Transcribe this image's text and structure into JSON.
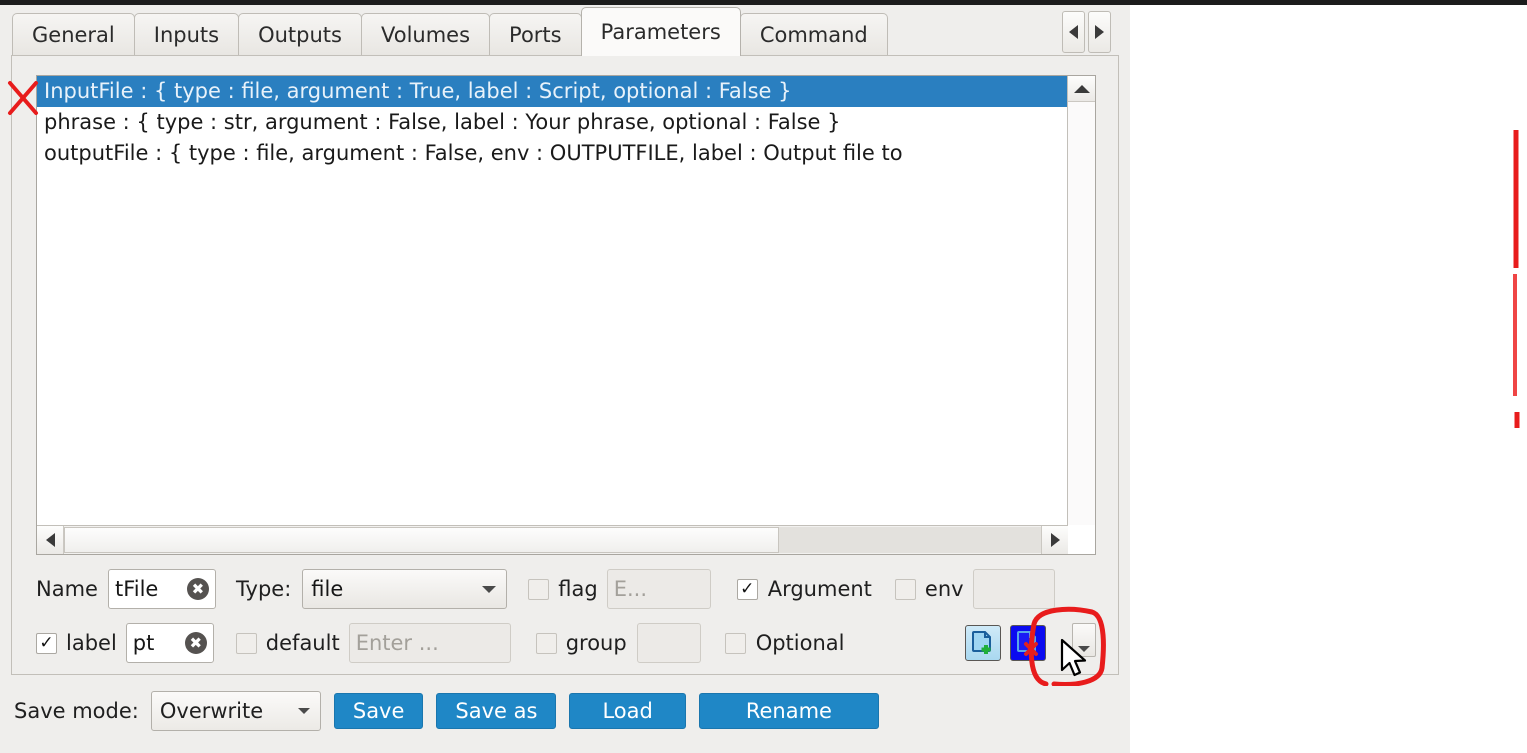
{
  "window": {
    "tabs": [
      {
        "label": "General",
        "active": false
      },
      {
        "label": "Inputs",
        "active": false
      },
      {
        "label": "Outputs",
        "active": false
      },
      {
        "label": "Volumes",
        "active": false
      },
      {
        "label": "Ports",
        "active": false
      },
      {
        "label": "Parameters",
        "active": true
      },
      {
        "label": "Command",
        "active": false
      }
    ],
    "tab_scroll_left": "◀",
    "tab_scroll_right": "▶"
  },
  "parameter_list": {
    "items": [
      {
        "text": "InputFile : { type : file,  argument : True,  label : Script,  optional : False }",
        "selected": true
      },
      {
        "text": "phrase : { type : str,  argument : False,  label : Your phrase,  optional : False }",
        "selected": false
      },
      {
        "text": "outputFile : { type : file,  argument : False,  env : OUTPUTFILE,  label : Output file to",
        "selected": false
      }
    ]
  },
  "editor": {
    "name_label": "Name",
    "name_value": "tFile",
    "name_clear": "✖",
    "type_label": "Type:",
    "type_value": "file",
    "flag_label": "flag",
    "flag_checked": false,
    "flag_value": "",
    "flag_placeholder": "E...",
    "argument_label": "Argument",
    "argument_checked": true,
    "env_label": "env",
    "env_checked": false,
    "env_value": "",
    "label_label": "label",
    "label_checked": true,
    "label_value": "pt",
    "label_clear": "✖",
    "default_label": "default",
    "default_checked": false,
    "default_value": "",
    "default_placeholder": "Enter ...",
    "group_label": "group",
    "group_checked": false,
    "group_value": "",
    "optional_label": "Optional",
    "optional_checked": false,
    "add_icon": "add-parameter-icon",
    "delete_icon": "delete-parameter-icon",
    "checkmark": "✓"
  },
  "savebar": {
    "save_mode_label": "Save mode:",
    "save_mode_value": "Overwrite",
    "buttons": [
      {
        "label": "Save"
      },
      {
        "label": "Save as"
      },
      {
        "label": "Load"
      },
      {
        "label": "Rename"
      }
    ]
  },
  "annotations": {
    "x_mark": "red-x-mark",
    "highlight_circle": "red-circle-highlight",
    "right_edge_line": "red-vertical-line",
    "cursor": "mouse-pointer"
  },
  "colors": {
    "selection_blue": "#2a7fc0",
    "button_blue": "#1f87c6",
    "delete_button_blue": "#0b0bf0",
    "annotation_red": "#e81c1c",
    "panel_bg": "#efeeec"
  }
}
